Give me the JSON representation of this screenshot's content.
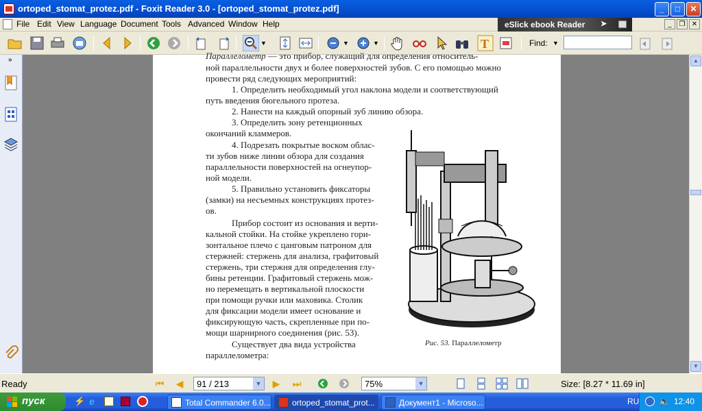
{
  "window": {
    "title": "ortoped_stomat_protez.pdf - Foxit Reader 3.0 - [ortoped_stomat_protez.pdf]",
    "min_label": "_",
    "max_label": "□",
    "close_label": "✕"
  },
  "menu": [
    "File",
    "Edit",
    "View",
    "Language",
    "Document",
    "Tools",
    "Advanced",
    "Window",
    "Help"
  ],
  "ad_banner": {
    "text": "eSlick ebook Reader"
  },
  "mdi": {
    "min": "_",
    "restore": "❐",
    "close": "✕"
  },
  "find": {
    "label": "Find:",
    "value": ""
  },
  "document_text": {
    "l1a": "Параллелометр",
    "l1b": " — это прибор, служащий для определения относитель-",
    "l2": "ной параллельности двух и более поверхностей зубов. С его помощью можно",
    "l3": "провести ряд следующих мероприятий:",
    "l4": "1. Определить необходимый угол наклона модели и соответствующий",
    "l5": "путь введения бюгельного протеза.",
    "l6": "2. Нанести на каждый опорный зуб линию обзора.",
    "l7": "3. Определить    зону    ретенционных",
    "l8": "окончаний кламмеров.",
    "l9": "4. Подрезать покрытые воском облас-",
    "l10": "ти зубов ниже линии обзора для создания",
    "l11": "параллельности поверхностей на огнеупор-",
    "l12": "ной модели.",
    "l13": "5. Правильно установить фиксаторы",
    "l14": "(замки) на несъемных конструкциях протез-",
    "l15": "ов.",
    "l16": "Прибор состоит из основания и верти-",
    "l17": "кальной стойки. На стойке укреплено гори-",
    "l18": "зонтальное плечо с цанговым патроном для",
    "l19": "стержней: стержень для анализа, графитовый",
    "l20": "стержень, три стержня для определения глу-",
    "l21": "бины ретенции. Графитовый стержень мож-",
    "l22": "но перемещать в вертикальной плоскости",
    "l23": "при помощи ручки или маховика. Столик",
    "l24": "для фиксации модели имеет основание и",
    "l25": "фиксирующую часть, скрепленные при по-",
    "l26": "мощи шарнирного соединения (рис. 53).",
    "l27": "Существует два вида устройства",
    "l28": "параллелометра:",
    "caption_a": "Рис. 53.",
    "caption_b": " Параллелометр"
  },
  "status": {
    "ready": "Ready",
    "page": "91 / 213",
    "zoom": "75%",
    "size": "Size: [8.27 * 11.69 in]"
  },
  "taskbar": {
    "start": "пуск",
    "tasks": [
      "Total Commander 6.0...",
      "ortoped_stomat_prot...",
      "Документ1 - Microso..."
    ],
    "lang": "RU",
    "clock": "12:40"
  }
}
